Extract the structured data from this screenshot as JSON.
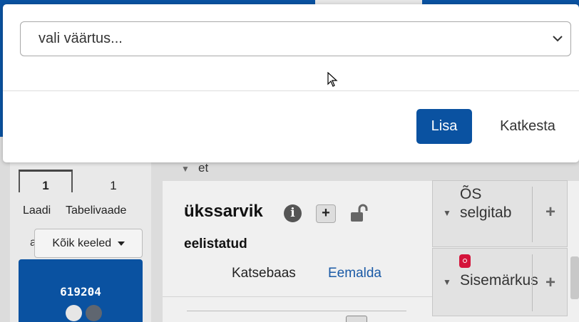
{
  "modal": {
    "select_value": "vali väärtus...",
    "add_label": "Lisa",
    "cancel_label": "Katkesta"
  },
  "left_panel": {
    "tabs": [
      {
        "label": "Laadi",
        "count": "1"
      },
      {
        "label": "Tabelivaade",
        "count": "1"
      }
    ],
    "partial_text": "a",
    "language_button": "Kõik keeled",
    "card_id": "619204",
    "colors": {
      "card": "#0a52a1",
      "dot_light": "#e6e6e6",
      "dot_dark": "#5f6670"
    }
  },
  "main": {
    "lang_row": "et",
    "term": "ükssarvik",
    "preferred_label": "eelistatud",
    "test_link": "Katsebaas",
    "remove_link": "Eemalda",
    "side_boxes": [
      {
        "label": "ÕS selgitab"
      },
      {
        "label": "Sisemärkus"
      }
    ],
    "side_box_add": "+",
    "add_symbol": "+"
  },
  "colors": {
    "primary": "#0a52a1",
    "link": "#1a5aa6",
    "badge_red": "#d4133a"
  }
}
